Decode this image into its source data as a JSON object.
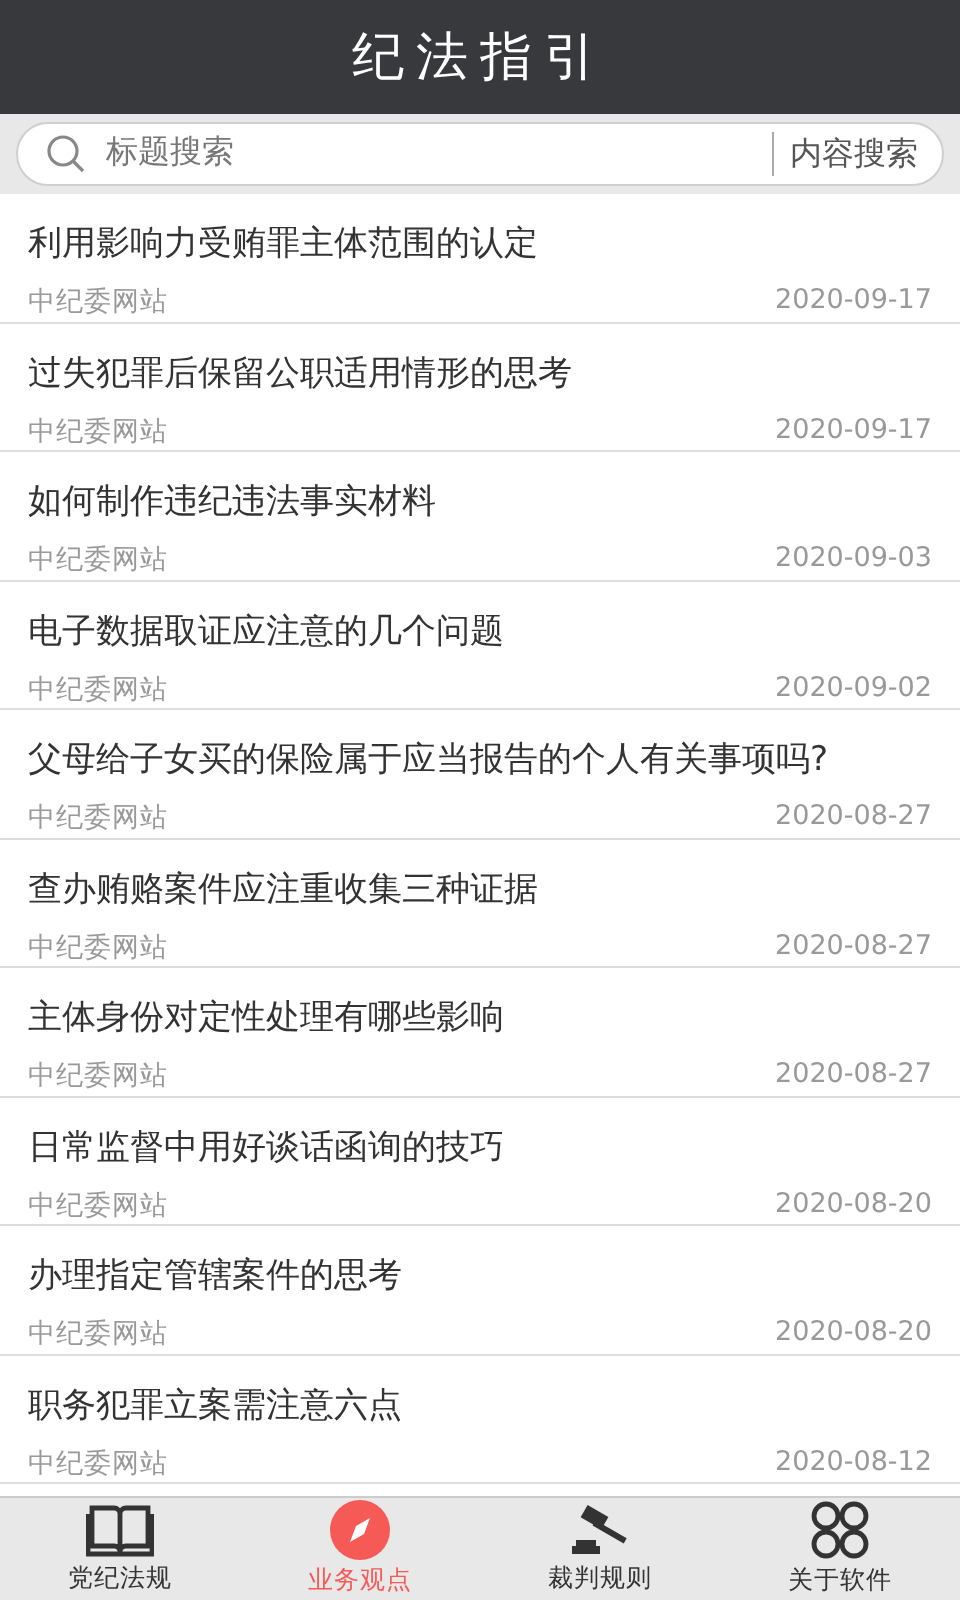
{
  "header": {
    "title": "纪法指引"
  },
  "search": {
    "placeholder": "标题搜索",
    "button": "内容搜索"
  },
  "articles": [
    {
      "title": "利用影响力受贿罪主体范围的认定",
      "source": "中纪委网站",
      "date": "2020-09-17"
    },
    {
      "title": "过失犯罪后保留公职适用情形的思考",
      "source": "中纪委网站",
      "date": "2020-09-17"
    },
    {
      "title": "如何制作违纪违法事实材料",
      "source": "中纪委网站",
      "date": "2020-09-03"
    },
    {
      "title": "电子数据取证应注意的几个问题",
      "source": "中纪委网站",
      "date": "2020-09-02"
    },
    {
      "title": "父母给子女买的保险属于应当报告的个人有关事项吗?",
      "source": "中纪委网站",
      "date": "2020-08-27"
    },
    {
      "title": "查办贿赂案件应注重收集三种证据",
      "source": "中纪委网站",
      "date": "2020-08-27"
    },
    {
      "title": "主体身份对定性处理有哪些影响",
      "source": "中纪委网站",
      "date": "2020-08-27"
    },
    {
      "title": "日常监督中用好谈话函询的技巧",
      "source": "中纪委网站",
      "date": "2020-08-20"
    },
    {
      "title": "办理指定管辖案件的思考",
      "source": "中纪委网站",
      "date": "2020-08-20"
    },
    {
      "title": "职务犯罪立案需注意六点",
      "source": "中纪委网站",
      "date": "2020-08-12"
    }
  ],
  "tabs": [
    {
      "kind": "book",
      "label": "党纪法规",
      "selected": false
    },
    {
      "kind": "compass",
      "label": "业务观点",
      "selected": true
    },
    {
      "kind": "gavel",
      "label": "裁判规则",
      "selected": false
    },
    {
      "kind": "grid",
      "label": "关于软件",
      "selected": false
    }
  ]
}
